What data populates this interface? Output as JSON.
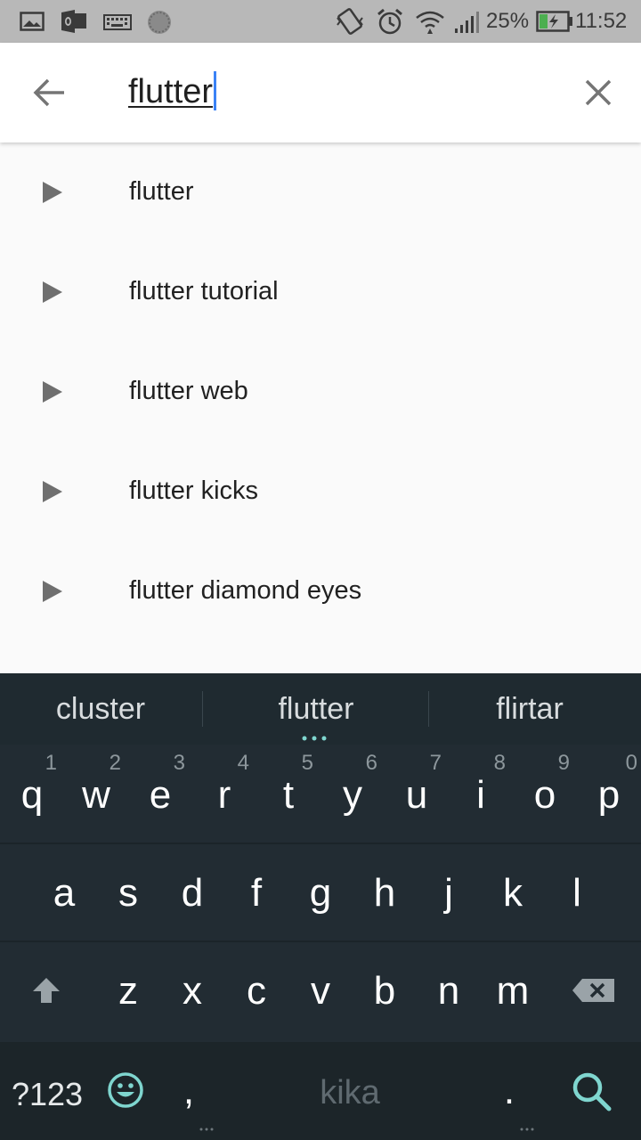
{
  "status_bar": {
    "battery_percent": "25%",
    "time": "11:52",
    "left_icons": [
      "image-icon",
      "outlook-icon",
      "keyboard-icon",
      "loader-icon"
    ],
    "right_icons": [
      "vibrate-icon",
      "alarm-icon",
      "wifi-icon",
      "signal-icon",
      "battery-charging-icon"
    ]
  },
  "search": {
    "query": "flutter",
    "back_icon": "arrow-left-icon",
    "clear_icon": "close-icon"
  },
  "suggestions": [
    {
      "label": "flutter"
    },
    {
      "label": "flutter tutorial"
    },
    {
      "label": "flutter web"
    },
    {
      "label": "flutter kicks"
    },
    {
      "label": "flutter diamond eyes"
    }
  ],
  "keyboard": {
    "candidates": [
      "cluster",
      "flutter",
      "flirtar"
    ],
    "row1": [
      {
        "ch": "q",
        "num": "1"
      },
      {
        "ch": "w",
        "num": "2"
      },
      {
        "ch": "e",
        "num": "3"
      },
      {
        "ch": "r",
        "num": "4"
      },
      {
        "ch": "t",
        "num": "5"
      },
      {
        "ch": "y",
        "num": "6"
      },
      {
        "ch": "u",
        "num": "7"
      },
      {
        "ch": "i",
        "num": "8"
      },
      {
        "ch": "o",
        "num": "9"
      },
      {
        "ch": "p",
        "num": "0"
      }
    ],
    "row2": [
      "a",
      "s",
      "d",
      "f",
      "g",
      "h",
      "j",
      "k",
      "l"
    ],
    "row3": [
      "z",
      "x",
      "c",
      "v",
      "b",
      "n",
      "m"
    ],
    "symbols_label": "?123",
    "comma_label": ",",
    "space_label": "kika",
    "period_label": ".",
    "accent_color": "#7fd6cf"
  }
}
